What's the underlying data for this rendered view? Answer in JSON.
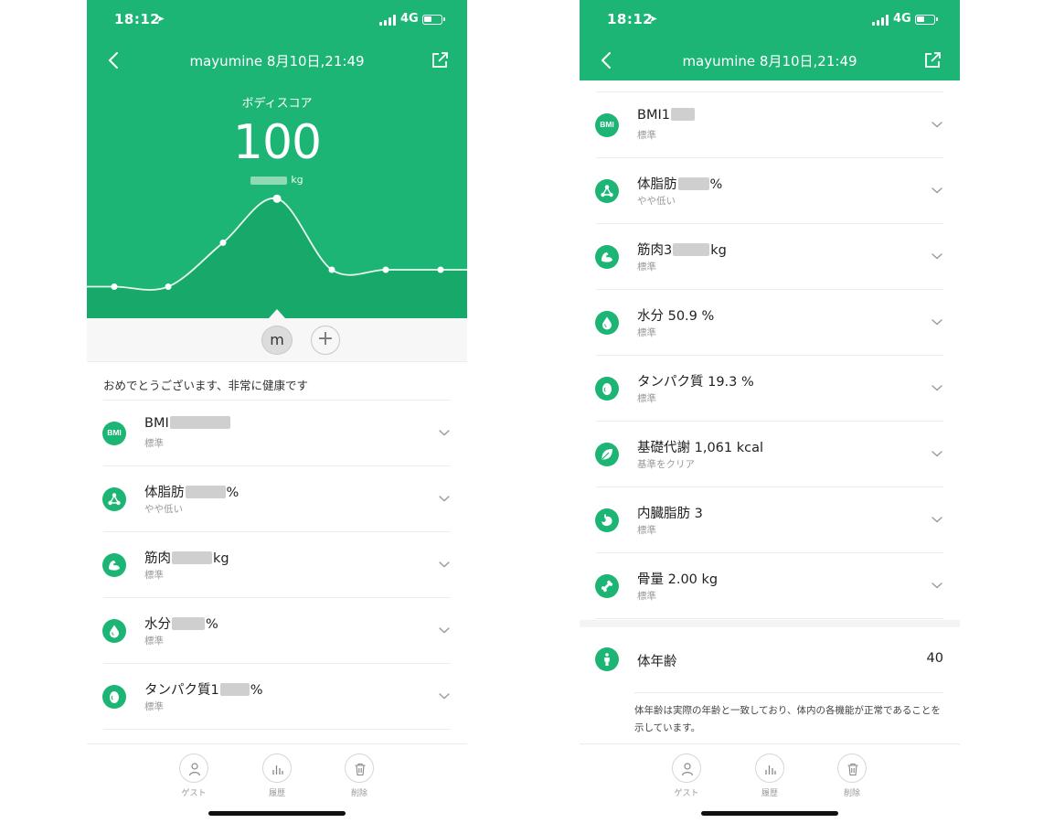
{
  "status_bar": {
    "time": "18:12",
    "network": "4G"
  },
  "header": {
    "title": "mayumine 8月10日,21:49"
  },
  "score": {
    "label": "ボディスコア",
    "value": "100",
    "weight_unit": "kg"
  },
  "user": {
    "initial": "m",
    "add": "+"
  },
  "message": "おめでとうございます、非常に健康です",
  "left_metrics": [
    {
      "label": "BMI",
      "suffix": "",
      "status": "標準",
      "icon": "bmi-icon"
    },
    {
      "label": "体脂肪",
      "suffix": "%",
      "status": "やや低い",
      "icon": "molecule-icon"
    },
    {
      "label": "筋肉",
      "suffix": "kg",
      "status": "標準",
      "icon": "muscle-icon"
    },
    {
      "label": "水分",
      "suffix": "%",
      "status": "標準",
      "icon": "drop-icon"
    },
    {
      "label": "タンパク質",
      "prefix_digit": "1",
      "suffix": "%",
      "status": "標準",
      "icon": "egg-icon"
    }
  ],
  "right_metrics": [
    {
      "label": "BMI",
      "prefix_digit": "1",
      "suffix": "",
      "status": "標準",
      "icon": "bmi-icon"
    },
    {
      "label": "体脂肪",
      "suffix": "%",
      "status": "やや低い",
      "icon": "molecule-icon"
    },
    {
      "label": "筋肉",
      "prefix_digit": "3",
      "suffix": "kg",
      "status": "標準",
      "icon": "muscle-icon"
    },
    {
      "label": "水分 50.9 %",
      "status": "標準",
      "icon": "drop-icon"
    },
    {
      "label": "タンパク質 19.3 %",
      "status": "標準",
      "icon": "egg-icon"
    },
    {
      "label": "基礎代謝 1,061 kcal",
      "status": "基準をクリア",
      "icon": "leaf-icon"
    },
    {
      "label": "内臓脂肪 3",
      "status": "標準",
      "icon": "stomach-icon"
    },
    {
      "label": "骨量 2.00 kg",
      "status": "標準",
      "icon": "bone-icon"
    }
  ],
  "body_age": {
    "label": "体年齢",
    "value": "40",
    "description": "体年齢は実際の年齢と一致しており、体内の各機能が正常であることを示しています。"
  },
  "bottom_bar": {
    "guest": "ゲスト",
    "history": "履歴",
    "delete": "削除"
  },
  "colors": {
    "brand": "#1db575",
    "chart_fill": "#17a96a",
    "line": "#e8f8ef"
  },
  "chart_data": {
    "type": "line",
    "values": [
      28,
      28,
      67,
      106,
      43,
      43,
      43
    ],
    "highlight_index": 3
  }
}
